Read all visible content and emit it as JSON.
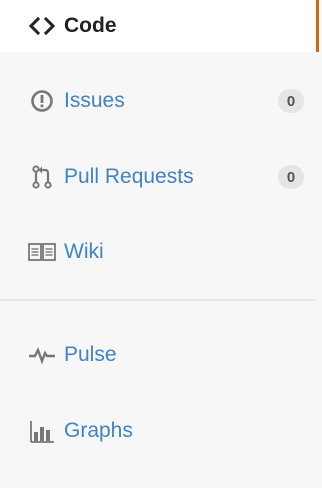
{
  "nav": {
    "code": {
      "label": "Code",
      "icon": "code-icon"
    },
    "issues": {
      "label": "Issues",
      "icon": "issue-opened-icon",
      "count": "0"
    },
    "pull_requests": {
      "label": "Pull Requests",
      "icon": "git-pull-request-icon",
      "count": "0"
    },
    "wiki": {
      "label": "Wiki",
      "icon": "book-icon"
    },
    "pulse": {
      "label": "Pulse",
      "icon": "pulse-icon"
    },
    "graphs": {
      "label": "Graphs",
      "icon": "graph-icon"
    }
  },
  "colors": {
    "link": "#4183c4",
    "selected_text": "#222222",
    "selected_accent": "#d26911",
    "counter_bg": "#e5e5e5",
    "panel_bg": "#f7f7f7"
  }
}
